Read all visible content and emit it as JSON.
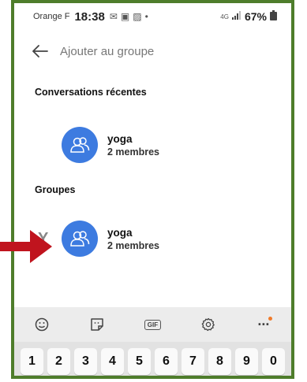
{
  "status": {
    "carrier": "Orange F",
    "time": "18:38",
    "network": "4G",
    "battery": "67%"
  },
  "header": {
    "title": "Ajouter au groupe"
  },
  "recent": {
    "label": "Conversations récentes",
    "items": [
      {
        "name": "yoga",
        "members": "2 membres"
      }
    ]
  },
  "groups": {
    "label": "Groupes",
    "index_letter": "Y",
    "items": [
      {
        "name": "yoga",
        "members": "2 membres"
      }
    ]
  },
  "keyboard": {
    "digits": [
      "1",
      "2",
      "3",
      "4",
      "5",
      "6",
      "7",
      "8",
      "9",
      "0"
    ],
    "toolbar": [
      "emoji-icon",
      "sticker-icon",
      "gif-icon",
      "settings-icon",
      "more-icon"
    ],
    "gif_label": "GIF"
  },
  "colors": {
    "avatar": "#3d7be0",
    "frame": "#4e7d2b",
    "annotation_arrow": "#c0141e"
  }
}
